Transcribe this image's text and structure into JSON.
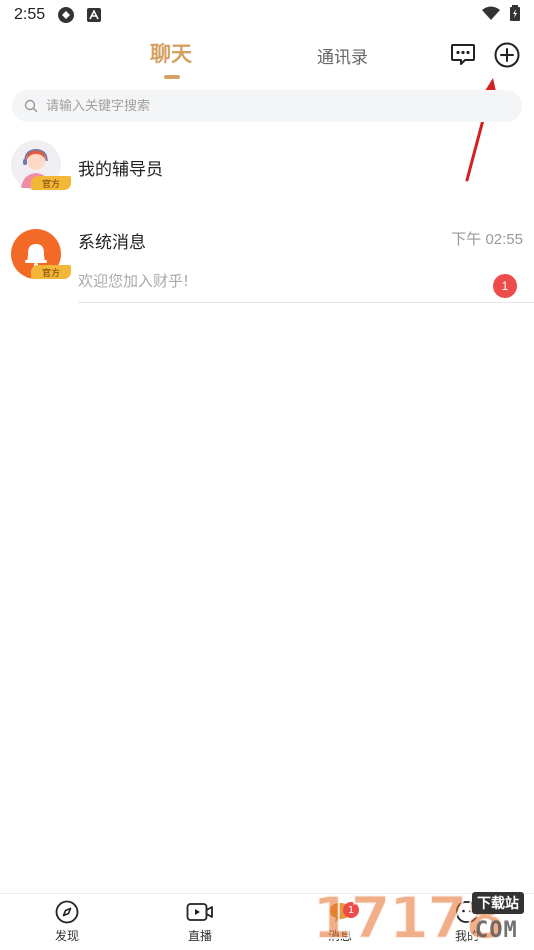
{
  "status_bar": {
    "time": "2:55"
  },
  "header": {
    "tab_chat": "聊天",
    "tab_contacts": "通讯录",
    "accent_color": "#d6a063"
  },
  "search": {
    "placeholder": "请输入关键字搜索"
  },
  "conversations": [
    {
      "title": "我的辅导员",
      "badge": "官方"
    },
    {
      "title": "系统消息",
      "badge": "官方",
      "time": "下午 02:55",
      "preview": "欢迎您加入财乎!",
      "unread": "1"
    }
  ],
  "bottom_nav": {
    "items": [
      {
        "label": "发现",
        "icon": "compass-icon"
      },
      {
        "label": "直播",
        "icon": "video-camera-icon"
      },
      {
        "label": "消息",
        "icon": "chat-bubble-icon",
        "badge": "1"
      },
      {
        "label": "我的",
        "icon": "profile-icon"
      }
    ]
  },
  "watermark": {
    "digits": "17178",
    "tag": "下载站",
    "domain": "COM"
  }
}
